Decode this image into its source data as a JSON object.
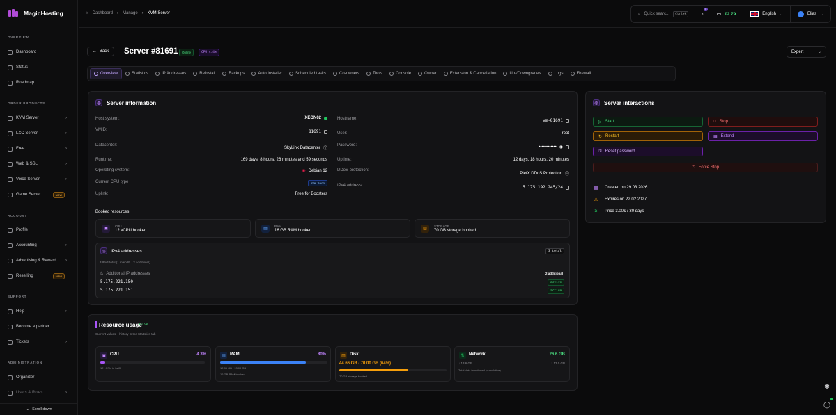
{
  "app": {
    "name": "MagicHosting"
  },
  "sidebar": {
    "sections": {
      "overview": "OVERVIEW",
      "order": "ORDER PRODUCTS",
      "account": "ACCOUNT",
      "support": "SUPPORT",
      "admin": "ADMINISTRATION"
    },
    "items": {
      "dashboard": "Dashboard",
      "status": "Status",
      "roadmap": "Roadmap",
      "kvm": "KVM Server",
      "lxc": "LXC Server",
      "free": "Free",
      "web": "Web & SSL",
      "voice": "Voice Server",
      "game": "Game Server",
      "profile": "Profile",
      "accounting": "Accounting",
      "advertising": "Advertising & Reward",
      "reselling": "Reselling",
      "help": "Help",
      "partner": "Become a partner",
      "tickets": "Tickets",
      "organizer": "Organizer",
      "users": "Users & Roles"
    },
    "new_badge": "NEW",
    "scroll": "Scroll down"
  },
  "topbar": {
    "breadcrumb": [
      "Dashboard",
      "Manage",
      "KVM Server"
    ],
    "search_placeholder": "Quick searc...",
    "search_kbd": "Ctrl+K",
    "notifications": "5",
    "balance": "€2.79",
    "language": "English",
    "user": "Elias"
  },
  "server": {
    "back": "Back",
    "title": "Server #81691",
    "status": "Online",
    "cpu_badge": "CPU 4.4%",
    "mode": "Expert"
  },
  "tabs": [
    "Overview",
    "Statistics",
    "IP Addresses",
    "Reinstall",
    "Backups",
    "Auto installer",
    "Scheduled tasks",
    "Co-owners",
    "Tools",
    "Console",
    "Owner",
    "Extension & Cancellation",
    "Up-/Downgrades",
    "Logs",
    "Firewall"
  ],
  "info": {
    "title": "Server information",
    "host_system_label": "Host system:",
    "host_system": "XEON02",
    "vmid_label": "VMID:",
    "vmid": "81691",
    "datacenter_label": "Datacenter:",
    "datacenter": "SkyLink Datacenter",
    "runtime_label": "Runtime:",
    "runtime": "169 days, 8 hours, 26 minutes and 59 seconds",
    "os_label": "Operating system:",
    "os": "Debian 12",
    "cpu_type_label": "Current CPU type",
    "cpu_type": "Intel Xeon",
    "uplink_label": "Uplink:",
    "uplink": "Free for Boosters",
    "hostname_label": "Hostname:",
    "hostname": "vm-81691",
    "user_label": "User:",
    "user": "root",
    "password_label": "Password:",
    "password": "••••••••••••",
    "uptime_label": "Uptime:",
    "uptime": "12 days, 18 hours, 20 minutes",
    "ddos_label": "DDoS protection:",
    "ddos": "PletX DDoS Protection",
    "ipv4_label": "IPv4 address:",
    "ipv4": "5.175.192.245/24"
  },
  "booked": {
    "title": "Booked resources",
    "cpu_label": "CPU",
    "cpu_value": "12 vCPU booked",
    "ram_label": "RAM",
    "ram_value": "16 GB RAM booked",
    "storage_label": "STORAGE",
    "storage_value": "70 GB storage booked"
  },
  "ipv4": {
    "title": "IPv4 addresses",
    "total_badge": "3 total",
    "summary": "3 IPv4 total (1 main IP · 2 additional)",
    "additional_label": "Additional IP addresses",
    "additional_count": "2 additional",
    "ips": [
      {
        "ip": "5.175.221.150",
        "status": "active"
      },
      {
        "ip": "5.175.221.151",
        "status": "active"
      }
    ]
  },
  "usage": {
    "title": "Resource usage",
    "live": "Live",
    "subtitle": "Current values – history in the Statistics tab",
    "cpu": {
      "label": "CPU",
      "value": "4.3%",
      "percent": 4.3,
      "note": "12 vCPU in tariff"
    },
    "ram": {
      "label": "RAM",
      "value": "80%",
      "percent": 80,
      "detail": "12.85 GB / 13.00 GB",
      "note": "16 GB RAM booked"
    },
    "disk": {
      "label": "Disk:",
      "value": "44.66 GB / 70.00 GB (64%)",
      "percent": 64,
      "note": "70 GB storage booked"
    },
    "network": {
      "label": "Network",
      "value": "26.6 GB",
      "down": "↓ 13.6 GB",
      "up": "↑ 13.0 GB",
      "note": "Total data transferred (cumulative)"
    }
  },
  "interactions": {
    "title": "Server interactions",
    "start": "Start",
    "stop": "Stop",
    "restart": "Restart",
    "extend": "Extend",
    "reset_password": "Reset password",
    "force_stop": "Force Stop",
    "created": "Created on 29.03.2026",
    "expires": "Expires on 22.02.2027",
    "price": "Price 3.00€ / 30 days"
  },
  "colors": {
    "accent": "#a855f7",
    "success": "#22c55e",
    "danger": "#ef4444",
    "warning": "#f59e0b",
    "ram_bar": "#3b82f6"
  }
}
